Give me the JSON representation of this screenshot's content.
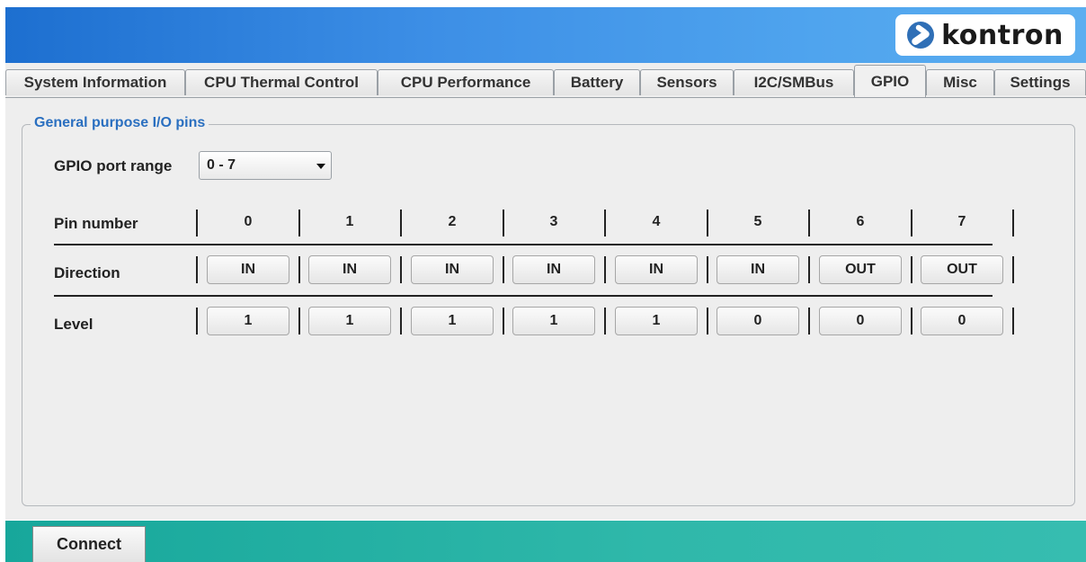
{
  "brand": {
    "logo_text": "kontron"
  },
  "tabs": [
    {
      "label": "System Information",
      "active": false
    },
    {
      "label": "CPU Thermal Control",
      "active": false
    },
    {
      "label": "CPU Performance",
      "active": false
    },
    {
      "label": "Battery",
      "active": false
    },
    {
      "label": "Sensors",
      "active": false
    },
    {
      "label": "I2C/SMBus",
      "active": false
    },
    {
      "label": "GPIO",
      "active": true
    },
    {
      "label": "Misc",
      "active": false
    },
    {
      "label": "Settings",
      "active": false
    }
  ],
  "gpio": {
    "group_title": "General purpose I/O pins",
    "port_range_label": "GPIO port range",
    "port_range_value": "0 - 7",
    "row_labels": {
      "pin": "Pin number",
      "direction": "Direction",
      "level": "Level"
    },
    "pins": [
      "0",
      "1",
      "2",
      "3",
      "4",
      "5",
      "6",
      "7"
    ],
    "directions": [
      "IN",
      "IN",
      "IN",
      "IN",
      "IN",
      "IN",
      "OUT",
      "OUT"
    ],
    "levels": [
      "1",
      "1",
      "1",
      "1",
      "1",
      "0",
      "0",
      "0"
    ]
  },
  "footer": {
    "connect_label": "Connect"
  },
  "colors": {
    "header_blue": "#3d8fe6",
    "footer_teal": "#2fb8aa",
    "group_title": "#2a6fc0"
  }
}
